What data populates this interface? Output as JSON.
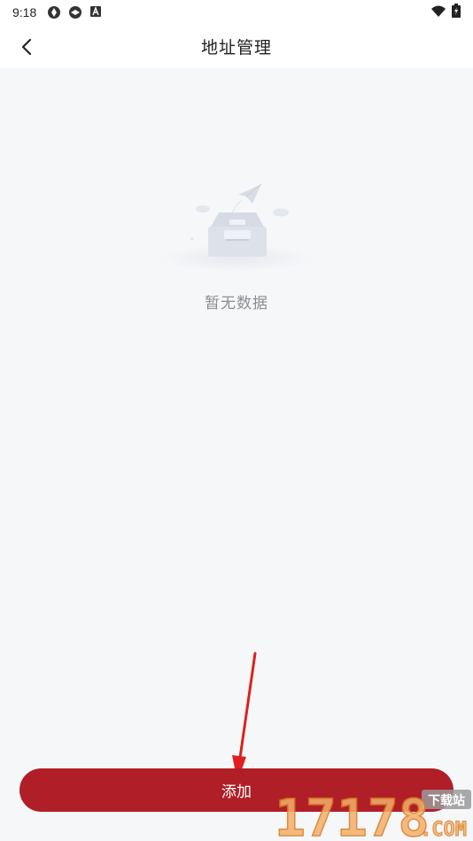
{
  "status_bar": {
    "time": "9:18",
    "icons": [
      "app-icon",
      "app-icon",
      "a-letter-icon"
    ],
    "right_icons": [
      "wifi-icon",
      "battery-charging-icon"
    ]
  },
  "header": {
    "title": "地址管理",
    "back_icon": "chevron-left-icon"
  },
  "empty_state": {
    "illustration": "empty-inbox-icon",
    "message": "暂无数据"
  },
  "footer": {
    "add_label": "添加"
  },
  "colors": {
    "accent": "#b01e27",
    "background": "#f6f7f9",
    "header_bg": "#ffffff",
    "annotation": "#e02020"
  },
  "watermark": {
    "text_top": "下载站",
    "text_main": "17178",
    "text_sub": ".COM"
  }
}
